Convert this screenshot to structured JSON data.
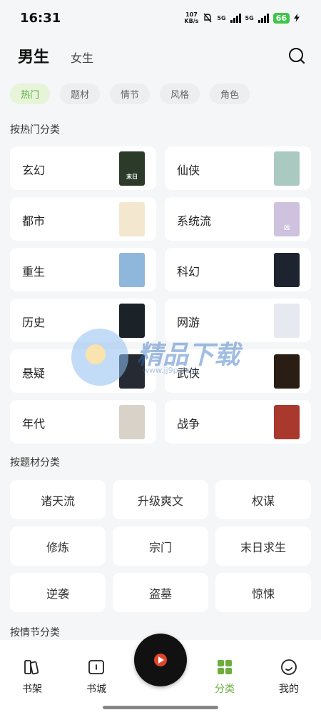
{
  "status": {
    "time": "16:31",
    "net_speed_value": "107",
    "net_speed_unit": "KB/s",
    "net1": "5G",
    "net2": "5G",
    "battery": "66"
  },
  "header": {
    "tab_male": "男生",
    "tab_female": "女生"
  },
  "filters": [
    "热门",
    "题材",
    "情节",
    "风格",
    "角色"
  ],
  "sections": {
    "hot": "按热门分类",
    "theme": "按题材分类",
    "plot": "按情节分类"
  },
  "genres": [
    {
      "name": "玄幻",
      "cover_color": "#2c3a2a",
      "cover_text": "末日"
    },
    {
      "name": "仙侠",
      "cover_color": "#a9c9c1",
      "cover_text": ""
    },
    {
      "name": "都市",
      "cover_color": "#f3e7cf",
      "cover_text": ""
    },
    {
      "name": "系统流",
      "cover_color": "#cfc2de",
      "cover_text": "凶"
    },
    {
      "name": "重生",
      "cover_color": "#8fb6db",
      "cover_text": ""
    },
    {
      "name": "科幻",
      "cover_color": "#1e2330",
      "cover_text": ""
    },
    {
      "name": "历史",
      "cover_color": "#1b2228",
      "cover_text": ""
    },
    {
      "name": "网游",
      "cover_color": "#e6e9f0",
      "cover_text": ""
    },
    {
      "name": "悬疑",
      "cover_color": "#262b33",
      "cover_text": ""
    },
    {
      "name": "武侠",
      "cover_color": "#2a1e14",
      "cover_text": ""
    },
    {
      "name": "年代",
      "cover_color": "#d9d2c8",
      "cover_text": ""
    },
    {
      "name": "战争",
      "cover_color": "#a8392c",
      "cover_text": ""
    }
  ],
  "themes": [
    "诸天流",
    "升级爽文",
    "权谋",
    "修炼",
    "宗门",
    "末日求生",
    "逆袭",
    "盗墓",
    "惊悚"
  ],
  "watermark": {
    "text": "精品下载",
    "url": "www.jj9p.com"
  },
  "nav": {
    "bookshelf": "书架",
    "bookstore": "书城",
    "category": "分类",
    "mine": "我的"
  },
  "colors": {
    "accent": "#6cae3e",
    "chip_active_bg": "#e7f4d9"
  }
}
